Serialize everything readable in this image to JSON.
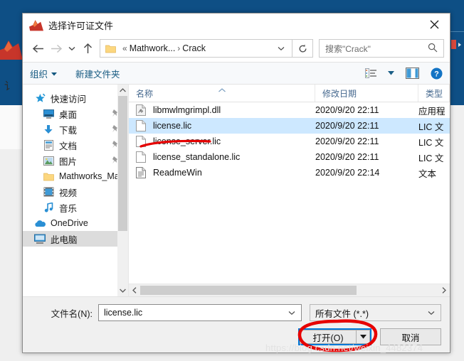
{
  "background": {
    "app_text_fragment": "讠",
    "matlab_logo_icon": "matlab-membrane-icon"
  },
  "dialog": {
    "title": "选择许可证文件",
    "title_icon": "matlab-membrane-icon",
    "close_icon": "close-icon",
    "nav": {
      "back_icon": "back-arrow-icon",
      "forward_icon": "forward-arrow-icon",
      "recent_icon": "chevron-down-icon",
      "up_icon": "up-arrow-icon",
      "folder_icon": "folder-icon",
      "breadcrumb_overflow": "«",
      "breadcrumb": [
        "Mathwork...",
        "Crack"
      ],
      "breadcrumb_separator": "›",
      "dropdown_icon": "chevron-down-icon",
      "refresh_icon": "refresh-icon",
      "search_placeholder": "搜索\"Crack\"",
      "search_icon": "search-icon"
    },
    "commandbar": {
      "organize_label": "组织",
      "organize_caret": "caret-down-icon",
      "new_folder_label": "新建文件夹",
      "view_icon": "list-view-icon",
      "view_caret": "caret-down-icon",
      "preview_pane_icon": "preview-pane-icon",
      "help_icon": "help-circle-icon"
    },
    "sidebar": {
      "scroll_up_icon": "scroll-up-icon",
      "scroll_down_icon": "scroll-down-icon",
      "items": [
        {
          "label": "快速访问",
          "icon": "quick-access-star-icon",
          "indent": false,
          "pinned": false,
          "selected": false
        },
        {
          "label": "桌面",
          "icon": "desktop-icon",
          "indent": true,
          "pinned": true,
          "selected": false
        },
        {
          "label": "下载",
          "icon": "downloads-icon",
          "indent": true,
          "pinned": true,
          "selected": false
        },
        {
          "label": "文档",
          "icon": "documents-icon",
          "indent": true,
          "pinned": true,
          "selected": false
        },
        {
          "label": "图片",
          "icon": "pictures-icon",
          "indent": true,
          "pinned": true,
          "selected": false
        },
        {
          "label": "Mathworks_Ma",
          "icon": "folder-icon",
          "indent": true,
          "pinned": false,
          "selected": false
        },
        {
          "label": "视频",
          "icon": "videos-icon",
          "indent": true,
          "pinned": false,
          "selected": false
        },
        {
          "label": "音乐",
          "icon": "music-icon",
          "indent": true,
          "pinned": false,
          "selected": false
        },
        {
          "label": "OneDrive",
          "icon": "onedrive-cloud-icon",
          "indent": false,
          "pinned": false,
          "selected": false
        },
        {
          "label": "此电脑",
          "icon": "this-pc-icon",
          "indent": false,
          "pinned": false,
          "selected": true
        }
      ]
    },
    "filelist": {
      "columns": [
        "名称",
        "修改日期",
        "类型"
      ],
      "sort_column": "名称",
      "sort_icon": "sort-ascending-icon",
      "rows": [
        {
          "name": "libmwlmgrimpl.dll",
          "date": "2020/9/20 22:11",
          "type": "应用程",
          "icon": "dll-file-icon",
          "selected": false
        },
        {
          "name": "license.lic",
          "date": "2020/9/20 22:11",
          "type": "LIC 文",
          "icon": "blank-file-icon",
          "selected": true
        },
        {
          "name": "license_server.lic",
          "date": "2020/9/20 22:11",
          "type": "LIC 文",
          "icon": "blank-file-icon",
          "selected": false
        },
        {
          "name": "license_standalone.lic",
          "date": "2020/9/20 22:11",
          "type": "LIC 文",
          "icon": "blank-file-icon",
          "selected": false
        },
        {
          "name": "ReadmeWin",
          "date": "2020/9/20 22:14",
          "type": "文本",
          "icon": "text-file-icon",
          "selected": false
        }
      ],
      "hscroll_left_icon": "scroll-left-icon",
      "hscroll_right_icon": "scroll-right-icon"
    },
    "footer": {
      "filename_label": "文件名(N):",
      "filename_value": "license.lic",
      "filename_chevron_icon": "chevron-down-icon",
      "filter_value": "所有文件 (*.*)",
      "filter_chevron_icon": "chevron-down-icon",
      "open_label": "打开(O)",
      "open_dropdown_icon": "caret-down-icon",
      "cancel_label": "取消"
    }
  },
  "annotations": {
    "underline_target": "license.lic",
    "ellipse_target": "打开(O)",
    "stroke_color": "#e60000"
  },
  "watermark": {
    "text": "https://blog.csdn.net/weixin_4482374"
  }
}
